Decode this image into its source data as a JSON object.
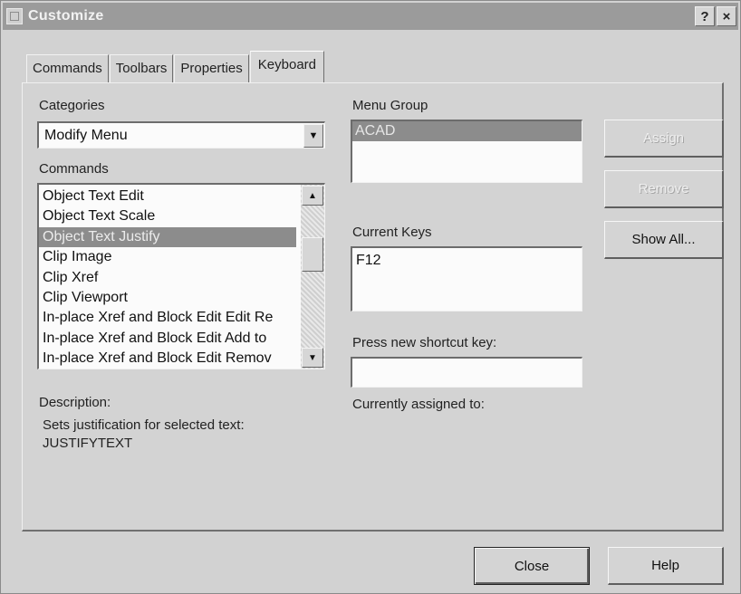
{
  "window": {
    "title": "Customize",
    "help_glyph": "?",
    "close_glyph": "×"
  },
  "tabs": [
    {
      "label": "Commands"
    },
    {
      "label": "Toolbars"
    },
    {
      "label": "Properties"
    },
    {
      "label": "Keyboard",
      "active": true
    }
  ],
  "categories": {
    "label": "Categories",
    "value": "Modify Menu"
  },
  "commands": {
    "label": "Commands",
    "items": [
      "Object Text Edit",
      "Object Text Scale",
      "Object Text Justify",
      "Clip Image",
      "Clip Xref",
      "Clip Viewport",
      "In-place Xref and Block Edit Edit Re",
      "In-place Xref and Block Edit Add to",
      "In-place Xref and Block Edit Remov"
    ],
    "selected_index": 2
  },
  "menu_group": {
    "label": "Menu Group",
    "items": [
      "ACAD"
    ]
  },
  "current_keys": {
    "label": "Current Keys",
    "items": [
      "F12"
    ]
  },
  "shortcut": {
    "label": "Press new shortcut key:",
    "value": ""
  },
  "assigned": {
    "label": "Currently assigned to:"
  },
  "description": {
    "label": "Description:",
    "line1": "Sets justification for selected text:",
    "line2": "JUSTIFYTEXT"
  },
  "buttons": {
    "assign": "Assign",
    "remove": "Remove",
    "show_all": "Show All...",
    "close": "Close",
    "help": "Help"
  },
  "icons": {
    "combo_arrow": "▼",
    "scroll_up": "▲",
    "scroll_down": "▼"
  }
}
